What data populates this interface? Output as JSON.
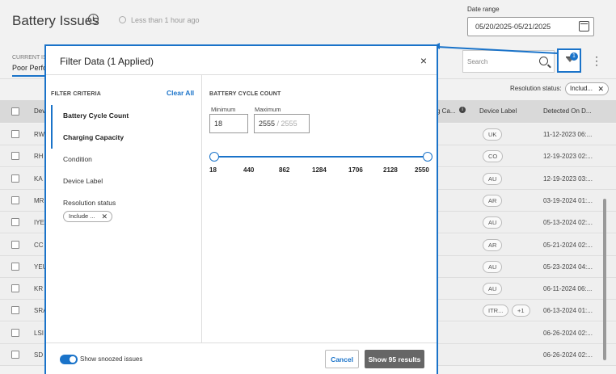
{
  "page": {
    "title": "Battery Issues",
    "updated": "Less than 1 hour ago",
    "date_range_label": "Date range",
    "date_range_value": "05/20/2025-05/21/2025",
    "current_label": "CURRENT IS",
    "current_tab": "Poor Perfo",
    "search_placeholder": "Search",
    "filter_badge": "1",
    "kebab": "⋮",
    "resolution_status_label": "Resolution status:",
    "resolution_chip": "Includ...",
    "chip_close": "✕",
    "columns": [
      "Dev",
      "g Ca...",
      "Device Label",
      "Detected On D..."
    ],
    "rows": [
      {
        "dev": "RW",
        "label": "UK",
        "extra": "",
        "date": "11-12-2023 06:..."
      },
      {
        "dev": "RH",
        "label": "CO",
        "extra": "",
        "date": "12-19-2023 02:..."
      },
      {
        "dev": "KA",
        "label": "AU",
        "extra": "",
        "date": "12-19-2023 03:..."
      },
      {
        "dev": "MR",
        "label": "AR",
        "extra": "",
        "date": "03-19-2024 01:..."
      },
      {
        "dev": "IYE",
        "label": "AU",
        "extra": "",
        "date": "05-13-2024 02:..."
      },
      {
        "dev": "CC",
        "label": "AR",
        "extra": "",
        "date": "05-21-2024 02:..."
      },
      {
        "dev": "YEU",
        "label": "AU",
        "extra": "",
        "date": "05-23-2024 04:..."
      },
      {
        "dev": "KR",
        "label": "AU",
        "extra": "",
        "date": "06-11-2024 06:..."
      },
      {
        "dev": "SRA",
        "label": "ITR...",
        "extra": "+1",
        "date": "06-13-2024 01:..."
      },
      {
        "dev": "LSI",
        "label": "",
        "extra": "",
        "date": "06-26-2024 02:..."
      },
      {
        "dev": "SD",
        "label": "",
        "extra": "",
        "date": "06-26-2024 02:..."
      }
    ]
  },
  "modal": {
    "title": "Filter Data (1 Applied)",
    "close": "×",
    "criteria_title": "FILTER CRITERIA",
    "clear_all": "Clear All",
    "criteria": [
      "Battery Cycle Count",
      "Charging Capacity",
      "Condition",
      "Device Label",
      "Resolution status"
    ],
    "resolution_chip": "Include ...",
    "panel_title": "BATTERY CYCLE COUNT",
    "min_label": "Minimum",
    "max_label": "Maximum",
    "min_value": "18",
    "max_value": "2555",
    "max_total": "/ 2555",
    "ticks": [
      "18",
      "440",
      "862",
      "1284",
      "1706",
      "2128",
      "2550"
    ],
    "snoozed_label": "Show snoozed issues",
    "cancel": "Cancel",
    "show_results": "Show 95 results"
  },
  "colors": {
    "accent": "#1a73c9",
    "primary_button": "#666666"
  }
}
